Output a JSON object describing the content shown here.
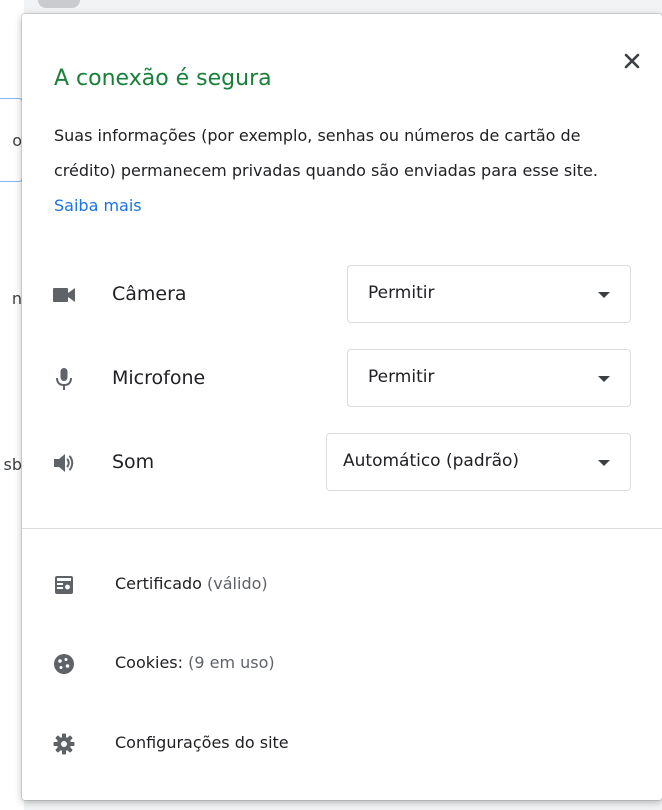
{
  "background": {
    "fragment1": "o",
    "fragment2": "n",
    "fragment3": "sb"
  },
  "bubble": {
    "title": "A conexão é segura",
    "description": "Suas informações (por exemplo, senhas ou números de cartão de crédito) permanecem privadas quando são enviadas para esse site.",
    "learn_more": "Saiba mais",
    "close_icon": "close-icon"
  },
  "permissions": [
    {
      "label": "Câmera",
      "value": "Permitir",
      "icon": "camera-icon"
    },
    {
      "label": "Microfone",
      "value": "Permitir",
      "icon": "microphone-icon"
    },
    {
      "label": "Som",
      "value": "Automático (padrão)",
      "icon": "speaker-icon"
    }
  ],
  "links": {
    "certificate": {
      "label": "Certificado",
      "status": "(válido)",
      "icon": "certificate-icon"
    },
    "cookies": {
      "label": "Cookies:",
      "status": "(9 em uso)",
      "icon": "cookie-icon"
    },
    "site_settings": {
      "label": "Configurações do site",
      "icon": "gear-icon"
    }
  },
  "colors": {
    "secure_green": "#188038",
    "link_blue": "#1a73e8",
    "icon_gray": "#5f6368"
  }
}
